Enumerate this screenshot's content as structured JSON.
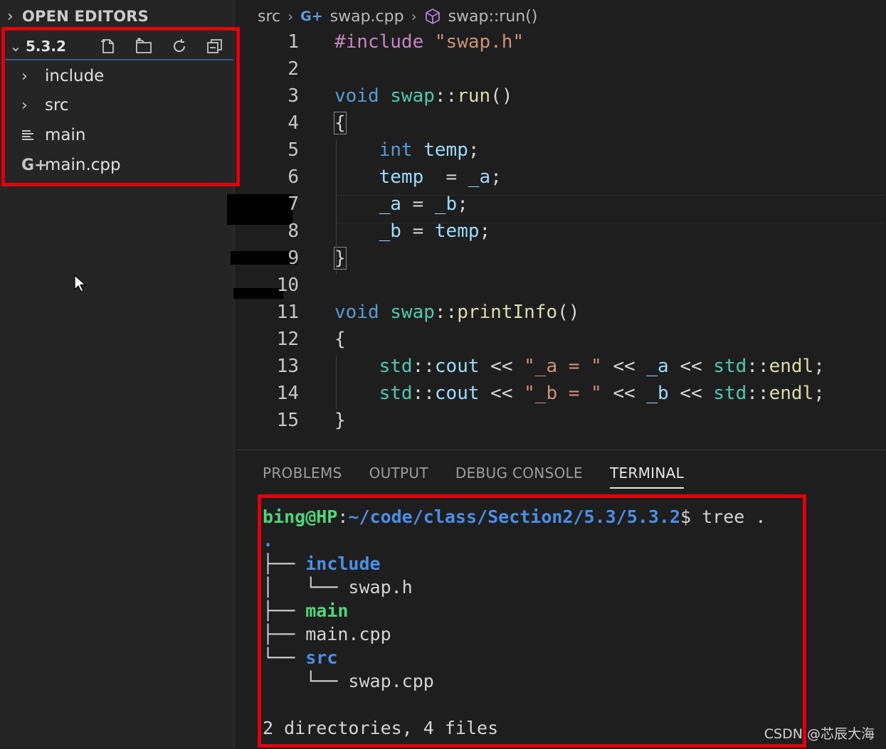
{
  "sidebar": {
    "section_title": "OPEN EDITORS",
    "folder_name": "5.3.2",
    "items": [
      {
        "label": "include",
        "icon": "chevron-right-icon"
      },
      {
        "label": "src",
        "icon": "chevron-right-icon"
      },
      {
        "label": "main",
        "icon": "text-file-icon"
      },
      {
        "label": "main.cpp",
        "icon": "cpp-file-icon"
      }
    ],
    "cpp_glyph": "G+",
    "chevron_right": "›",
    "chevron_down": "⌄"
  },
  "breadcrumb": {
    "folder": "src",
    "file": "swap.cpp",
    "symbol": "swap::run()"
  },
  "editor": {
    "lines": [
      {
        "n": "1",
        "tokens": [
          [
            "pp",
            "#include "
          ],
          [
            "str",
            "\"swap.h\""
          ]
        ]
      },
      {
        "n": "2",
        "tokens": []
      },
      {
        "n": "3",
        "tokens": [
          [
            "kw",
            "void "
          ],
          [
            "ty",
            "swap"
          ],
          [
            "",
            "::"
          ],
          [
            "fn",
            "run"
          ],
          [
            "",
            "()"
          ]
        ]
      },
      {
        "n": "4",
        "tokens": [
          [
            "",
            "{"
          ]
        ]
      },
      {
        "n": "5",
        "tokens": [
          [
            "",
            "    "
          ],
          [
            "kw",
            "int "
          ],
          [
            "id",
            "temp"
          ],
          [
            "",
            ";"
          ]
        ]
      },
      {
        "n": "6",
        "tokens": [
          [
            "",
            "    "
          ],
          [
            "id",
            "temp"
          ],
          [
            "",
            "  = "
          ],
          [
            "id",
            "_a"
          ],
          [
            "",
            ";"
          ]
        ]
      },
      {
        "n": "7",
        "tokens": [
          [
            "",
            "    "
          ],
          [
            "id",
            "_a"
          ],
          [
            "",
            " = "
          ],
          [
            "id",
            "_b"
          ],
          [
            "",
            ";"
          ]
        ]
      },
      {
        "n": "8",
        "tokens": [
          [
            "",
            "    "
          ],
          [
            "id",
            "_b"
          ],
          [
            "",
            " = "
          ],
          [
            "id",
            "temp"
          ],
          [
            "",
            ";"
          ]
        ]
      },
      {
        "n": "9",
        "tokens": [
          [
            "",
            "}"
          ]
        ]
      },
      {
        "n": "10",
        "tokens": []
      },
      {
        "n": "11",
        "tokens": [
          [
            "kw",
            "void "
          ],
          [
            "ty",
            "swap"
          ],
          [
            "",
            "::"
          ],
          [
            "fn",
            "printInfo"
          ],
          [
            "",
            "()"
          ]
        ]
      },
      {
        "n": "12",
        "tokens": [
          [
            "",
            "{"
          ]
        ]
      },
      {
        "n": "13",
        "tokens": [
          [
            "",
            "    "
          ],
          [
            "ty",
            "std"
          ],
          [
            "",
            "::"
          ],
          [
            "id",
            "cout"
          ],
          [
            "",
            " << "
          ],
          [
            "str",
            "\"_a = \""
          ],
          [
            "",
            " << "
          ],
          [
            "id",
            "_a"
          ],
          [
            "",
            " << "
          ],
          [
            "ty",
            "std"
          ],
          [
            "",
            "::"
          ],
          [
            "fn",
            "endl"
          ],
          [
            "",
            ";"
          ]
        ]
      },
      {
        "n": "14",
        "tokens": [
          [
            "",
            "    "
          ],
          [
            "ty",
            "std"
          ],
          [
            "",
            "::"
          ],
          [
            "id",
            "cout"
          ],
          [
            "",
            " << "
          ],
          [
            "str",
            "\"_b = \""
          ],
          [
            "",
            " << "
          ],
          [
            "id",
            "_b"
          ],
          [
            "",
            " << "
          ],
          [
            "ty",
            "std"
          ],
          [
            "",
            "::"
          ],
          [
            "fn",
            "endl"
          ],
          [
            "",
            ";"
          ]
        ]
      },
      {
        "n": "15",
        "tokens": [
          [
            "",
            "}"
          ]
        ]
      }
    ]
  },
  "panel": {
    "tabs": [
      {
        "label": "PROBLEMS",
        "active": false
      },
      {
        "label": "OUTPUT",
        "active": false
      },
      {
        "label": "DEBUG CONSOLE",
        "active": false
      },
      {
        "label": "TERMINAL",
        "active": true
      }
    ]
  },
  "terminal": {
    "prompt_user": "bing@HP",
    "prompt_colon": ":",
    "prompt_path": "~/code/class/Section2/5.3/5.3.2",
    "prompt_tail": "$ tree .",
    "root": ".",
    "entries": [
      {
        "prefix": "├── ",
        "name": "include",
        "kind": "dir"
      },
      {
        "prefix": "│   └── ",
        "name": "swap.h",
        "kind": "file"
      },
      {
        "prefix": "├── ",
        "name": "main",
        "kind": "exe"
      },
      {
        "prefix": "├── ",
        "name": "main.cpp",
        "kind": "file"
      },
      {
        "prefix": "└── ",
        "name": "src",
        "kind": "dir"
      },
      {
        "prefix": "    └── ",
        "name": "swap.cpp",
        "kind": "file"
      }
    ],
    "summary": "2 directories, 4 files"
  },
  "watermark": "CSDN @芯辰大海",
  "colors": {
    "highlight_box": "#e0000a",
    "keyword": "#569cd6",
    "type": "#4ec9b0",
    "function": "#dcdcaa",
    "string": "#ce9178",
    "identifier": "#9cdcfe",
    "terminal_dir": "#4a8fe8",
    "terminal_exe": "#4fd67a"
  }
}
